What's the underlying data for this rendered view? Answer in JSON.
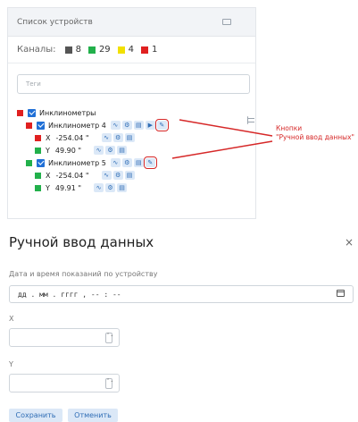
{
  "device_panel": {
    "title": "Список устройств",
    "channels": {
      "label": "Каналы:",
      "items": [
        {
          "count": "8",
          "color": "#555555"
        },
        {
          "count": "29",
          "color": "#22b04b"
        },
        {
          "count": "4",
          "color": "#f2e000"
        },
        {
          "count": "1",
          "color": "#e02020"
        }
      ]
    },
    "tags_placeholder": "Теги",
    "tree": {
      "root": "Инклинометры",
      "devices": [
        {
          "name": "Инклинометр 4",
          "rows": [
            {
              "axis": "X",
              "value": "-254.04 \""
            },
            {
              "axis": "Y",
              "value": "49.90 \""
            }
          ]
        },
        {
          "name": "Инклинометр 5",
          "rows": [
            {
              "axis": "X",
              "value": "-254.04 \""
            },
            {
              "axis": "Y",
              "value": "49.91 \""
            }
          ]
        }
      ]
    }
  },
  "annotation": {
    "text": "Кнопки\n\"Ручной ввод данных\"",
    "color": "#d62828"
  },
  "modal": {
    "title": "Ручной ввод данных",
    "close_symbol": "×",
    "date_label": "Дата и время показаний по устройству",
    "date_value": "дд . мм . гггг ,   -- : --",
    "x_label": "X",
    "y_label": "Y",
    "x_spin": "⌃⌄",
    "y_spin": "⌃⌄",
    "save": "Сохранить",
    "cancel": "Отменить"
  }
}
